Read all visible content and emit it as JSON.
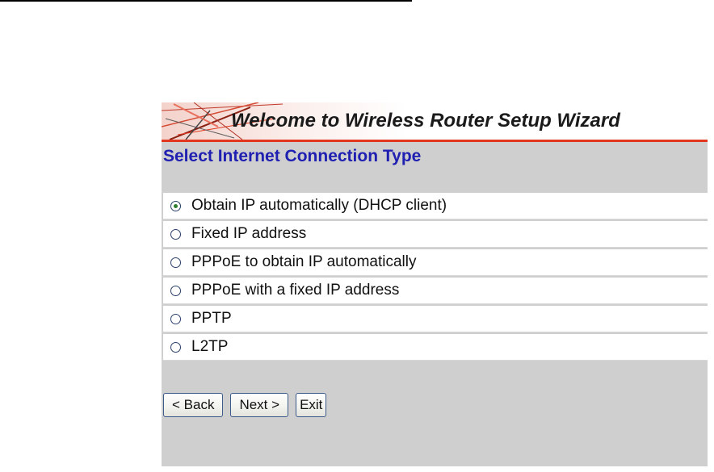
{
  "banner": {
    "title": "Welcome to Wireless Router Setup Wizard",
    "accent_color": "#e2361e"
  },
  "section": {
    "title": "Select Internet Connection Type",
    "title_color": "#1f1fb2"
  },
  "options": [
    {
      "label": "Obtain IP automatically (DHCP client)",
      "selected": true
    },
    {
      "label": "Fixed IP address",
      "selected": false
    },
    {
      "label": "PPPoE to obtain IP automatically",
      "selected": false
    },
    {
      "label": "PPPoE with a fixed IP address",
      "selected": false
    },
    {
      "label": "PPTP",
      "selected": false
    },
    {
      "label": "L2TP",
      "selected": false
    }
  ],
  "buttons": {
    "back": "< Back",
    "next": "Next >",
    "exit": "Exit"
  }
}
